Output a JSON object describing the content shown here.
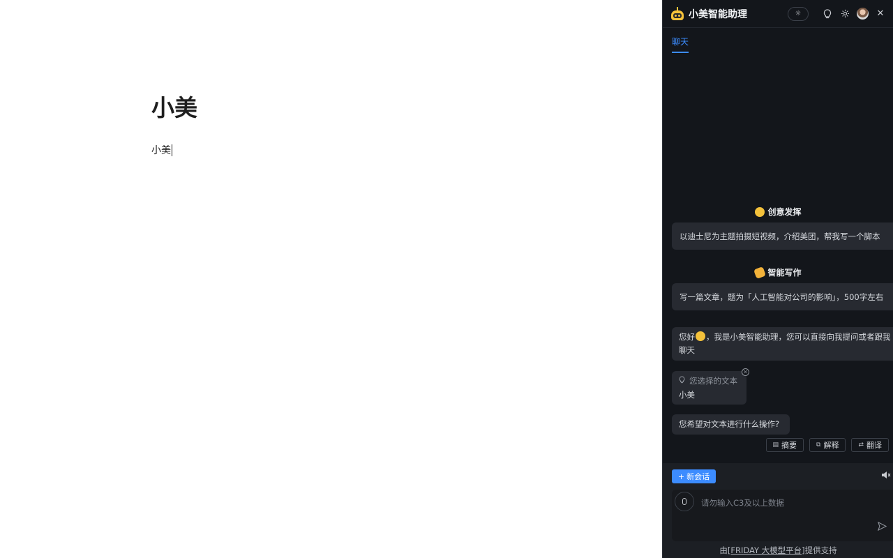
{
  "editor": {
    "title": "小美",
    "body": "小美"
  },
  "assistant": {
    "title": "小美智能助理",
    "tab": "聊天",
    "sections": [
      {
        "title": "创意发挥",
        "prompt": "以迪士尼为主题拍摄短视频，介绍美团，帮我写一个脚本"
      },
      {
        "title": "智能写作",
        "prompt": "写一篇文章，题为「人工智能对公司的影响」，500字左右"
      }
    ],
    "greeting_before": "您好",
    "greeting_after": "，我是小美智能助理，您可以直接向我提问或者跟我聊天",
    "selected_label": "您选择的文本",
    "selected_value": "小美",
    "question": "您希望对文本进行什么操作?",
    "actions": [
      "摘要",
      "解释",
      "翻译"
    ],
    "new_chat": "新会话",
    "input_placeholder": "请勿输入C3及以上数据",
    "footer_prefix": "由",
    "footer_link": "[FRIDAY 大模型平台]",
    "footer_suffix": "提供支持"
  },
  "colors": {
    "accent": "#3c8cff",
    "panel_bg": "#13161b",
    "bubble_bg": "#272a31"
  }
}
